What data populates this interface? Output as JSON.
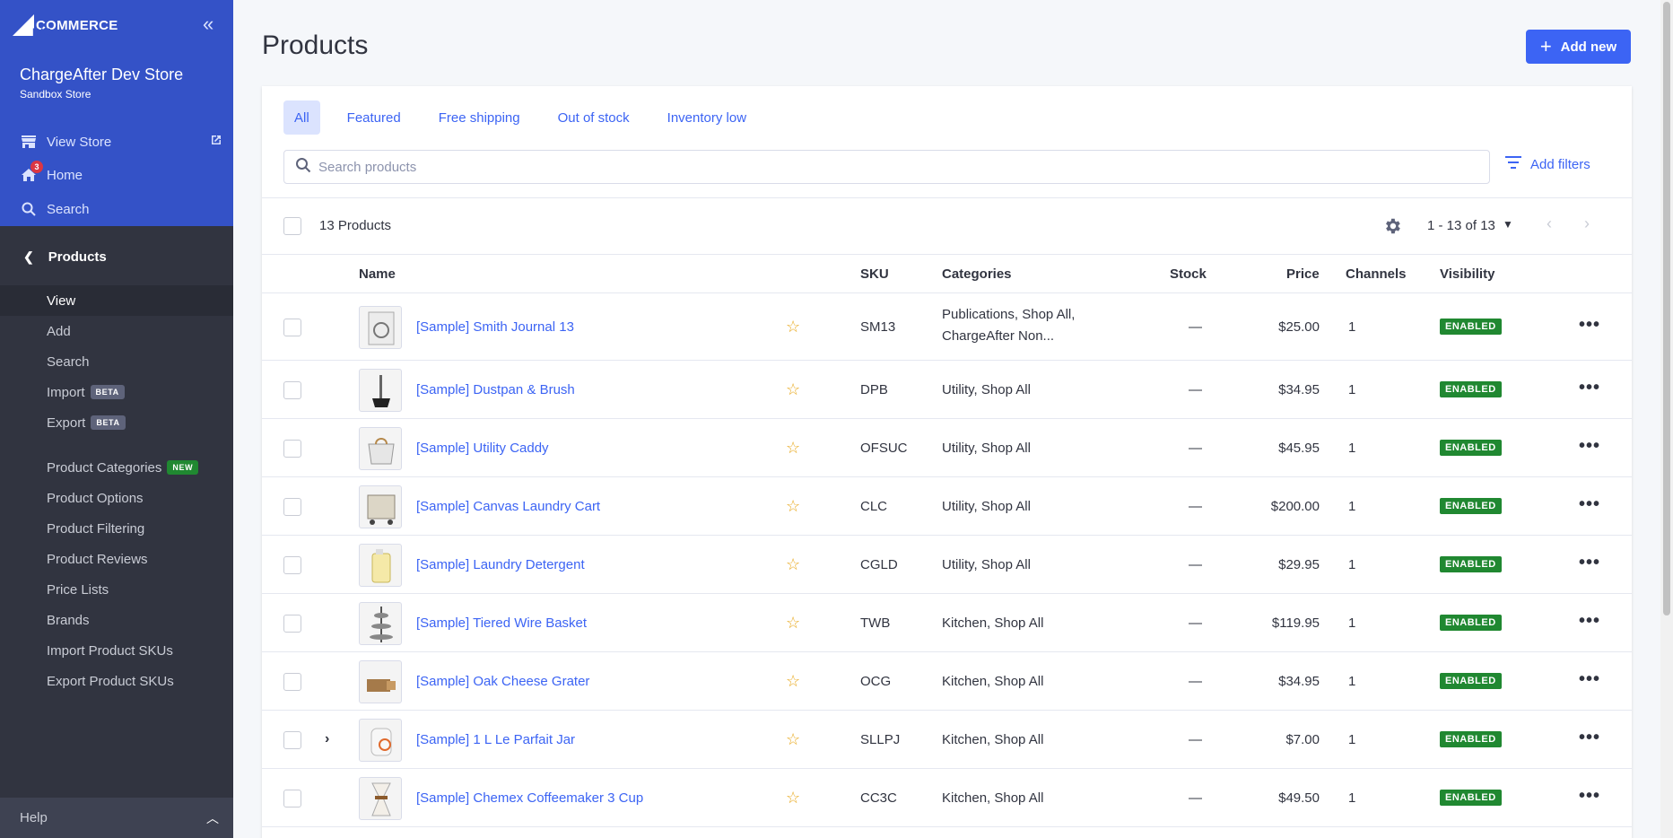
{
  "sidebar": {
    "logo_text": "COMMERCE",
    "logo_big": "BIG",
    "store_name": "ChargeAfter Dev Store",
    "store_type": "Sandbox Store",
    "links": [
      {
        "label": "View Store",
        "icon": "storefront-icon"
      },
      {
        "label": "Home",
        "icon": "home-icon",
        "badge": "3"
      },
      {
        "label": "Search",
        "icon": "search-icon"
      }
    ],
    "section": "Products",
    "sub_items": [
      {
        "label": "View",
        "active": true
      },
      {
        "label": "Add"
      },
      {
        "label": "Search"
      },
      {
        "label": "Import",
        "pill": "BETA"
      },
      {
        "label": "Export",
        "pill": "BETA"
      },
      {
        "label": "Product Categories",
        "pill": "NEW"
      },
      {
        "label": "Product Options"
      },
      {
        "label": "Product Filtering"
      },
      {
        "label": "Product Reviews"
      },
      {
        "label": "Price Lists"
      },
      {
        "label": "Brands"
      },
      {
        "label": "Import Product SKUs"
      },
      {
        "label": "Export Product SKUs"
      }
    ],
    "help": "Help"
  },
  "header": {
    "title": "Products",
    "add_new": "Add new"
  },
  "tabs": [
    "All",
    "Featured",
    "Free shipping",
    "Out of stock",
    "Inventory low"
  ],
  "search": {
    "placeholder": "Search products",
    "value": ""
  },
  "add_filters": "Add filters",
  "toolbar": {
    "count": "13 Products",
    "pager": "1 - 13 of 13"
  },
  "columns": {
    "name": "Name",
    "sku": "SKU",
    "categories": "Categories",
    "stock": "Stock",
    "price": "Price",
    "channels": "Channels",
    "visibility": "Visibility"
  },
  "products": [
    {
      "name": "[Sample] Smith Journal 13",
      "sku": "SM13",
      "categories": "Publications, Shop All, ChargeAfter Non...",
      "stock": "—",
      "price": "$25.00",
      "channels": "1",
      "visibility": "ENABLED"
    },
    {
      "name": "[Sample] Dustpan & Brush",
      "sku": "DPB",
      "categories": "Utility, Shop All",
      "stock": "—",
      "price": "$34.95",
      "channels": "1",
      "visibility": "ENABLED"
    },
    {
      "name": "[Sample] Utility Caddy",
      "sku": "OFSUC",
      "categories": "Utility, Shop All",
      "stock": "—",
      "price": "$45.95",
      "channels": "1",
      "visibility": "ENABLED"
    },
    {
      "name": "[Sample] Canvas Laundry Cart",
      "sku": "CLC",
      "categories": "Utility, Shop All",
      "stock": "—",
      "price": "$200.00",
      "channels": "1",
      "visibility": "ENABLED"
    },
    {
      "name": "[Sample] Laundry Detergent",
      "sku": "CGLD",
      "categories": "Utility, Shop All",
      "stock": "—",
      "price": "$29.95",
      "channels": "1",
      "visibility": "ENABLED"
    },
    {
      "name": "[Sample] Tiered Wire Basket",
      "sku": "TWB",
      "categories": "Kitchen, Shop All",
      "stock": "—",
      "price": "$119.95",
      "channels": "1",
      "visibility": "ENABLED"
    },
    {
      "name": "[Sample] Oak Cheese Grater",
      "sku": "OCG",
      "categories": "Kitchen, Shop All",
      "stock": "—",
      "price": "$34.95",
      "channels": "1",
      "visibility": "ENABLED"
    },
    {
      "name": "[Sample] 1 L Le Parfait Jar",
      "sku": "SLLPJ",
      "categories": "Kitchen, Shop All",
      "stock": "—",
      "price": "$7.00",
      "channels": "1",
      "visibility": "ENABLED",
      "expandable": true
    },
    {
      "name": "[Sample] Chemex Coffeemaker 3 Cup",
      "sku": "CC3C",
      "categories": "Kitchen, Shop All",
      "stock": "—",
      "price": "$49.50",
      "channels": "1",
      "visibility": "ENABLED"
    }
  ],
  "colors": {
    "sidebar_top": "#3452c7",
    "sidebar": "#313440",
    "accent": "#3c64f4",
    "enabled_badge": "#208831",
    "star": "#e8a81b"
  }
}
